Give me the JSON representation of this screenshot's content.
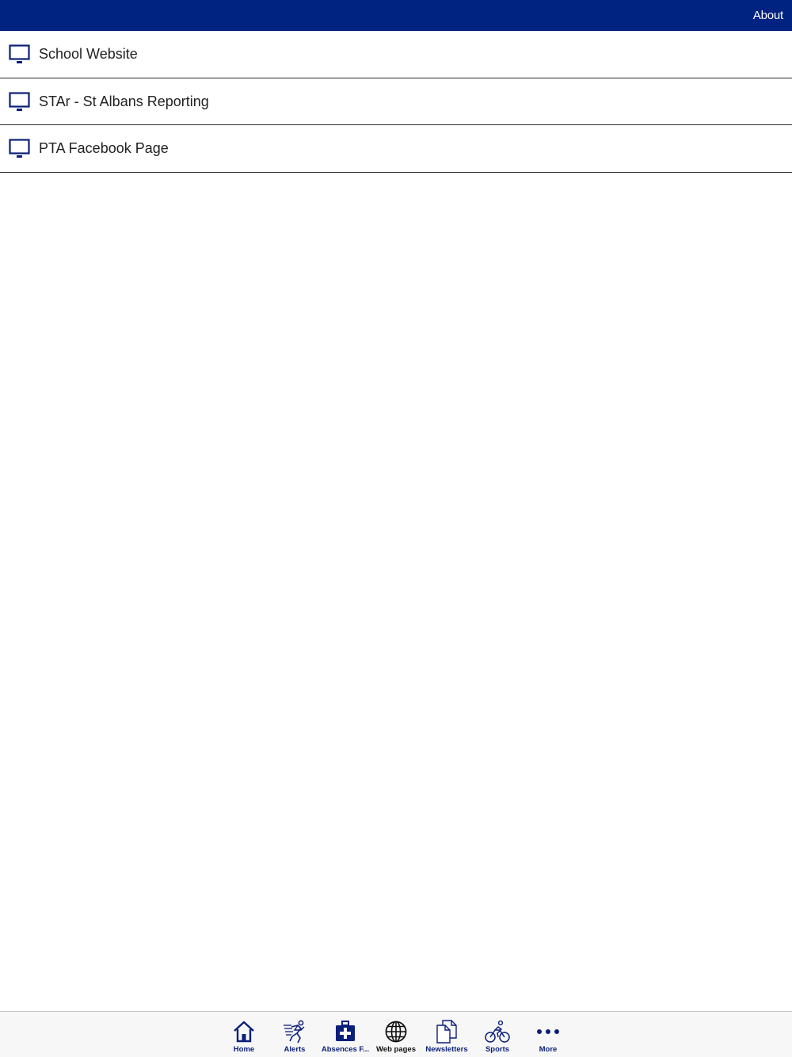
{
  "colors": {
    "brand": "#002280",
    "icon": "#0a1f7a",
    "tab_bar_bg": "#f7f7f7"
  },
  "navbar": {
    "about_label": "About"
  },
  "links": [
    {
      "label": "School Website",
      "icon": "monitor-icon"
    },
    {
      "label": "STAr - St Albans Reporting",
      "icon": "monitor-icon"
    },
    {
      "label": "PTA Facebook Page",
      "icon": "monitor-icon"
    }
  ],
  "tabs": [
    {
      "label": "Home",
      "icon": "home-icon"
    },
    {
      "label": "Alerts",
      "icon": "running-person-icon"
    },
    {
      "label": "Absences F...",
      "icon": "medical-kit-icon"
    },
    {
      "label": "Web pages",
      "icon": "globe-icon",
      "active": true
    },
    {
      "label": "Newsletters",
      "icon": "documents-icon"
    },
    {
      "label": "Sports",
      "icon": "cyclist-icon"
    },
    {
      "label": "More",
      "icon": "more-dots-icon"
    }
  ]
}
